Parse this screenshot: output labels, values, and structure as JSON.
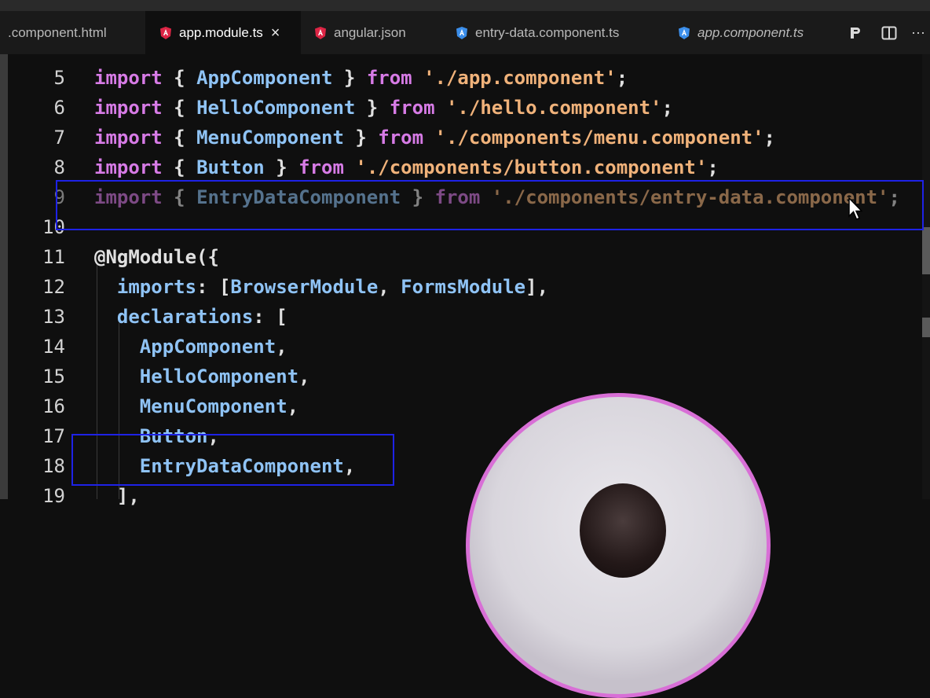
{
  "tabs": [
    {
      "label": ".component.html",
      "icon": "html-file-icon",
      "active": false,
      "italic": false
    },
    {
      "label": "app.module.ts",
      "icon": "angular-icon",
      "active": true,
      "italic": false,
      "close": "×"
    },
    {
      "label": "angular.json",
      "icon": "angular-icon",
      "active": false,
      "italic": false
    },
    {
      "label": "entry-data.component.ts",
      "icon": "angular-component-icon",
      "active": false,
      "italic": false
    },
    {
      "label": "app.component.ts",
      "icon": "angular-component-icon",
      "active": false,
      "italic": true
    }
  ],
  "toolbar": {
    "preview_icon": "preview-icon",
    "split_icon": "split-editor-icon",
    "more": "···"
  },
  "colors": {
    "keyword": "#d77be6",
    "identifier": "#8fc3f5",
    "string": "#f0b27a",
    "highlight_box": "#1e22e6",
    "angular_red": "#dd2545",
    "angular_blue": "#3b8eea"
  },
  "lines": [
    {
      "n": "5",
      "tokens": [
        [
          "kw",
          "import"
        ],
        [
          "pun",
          " { "
        ],
        [
          "id",
          "AppComponent"
        ],
        [
          "pun",
          " } "
        ],
        [
          "kw",
          "from"
        ],
        [
          "pun",
          " "
        ],
        [
          "str",
          "'./app.component'"
        ],
        [
          "pun",
          ";"
        ]
      ]
    },
    {
      "n": "6",
      "tokens": [
        [
          "kw",
          "import"
        ],
        [
          "pun",
          " { "
        ],
        [
          "id",
          "HelloComponent"
        ],
        [
          "pun",
          " } "
        ],
        [
          "kw",
          "from"
        ],
        [
          "pun",
          " "
        ],
        [
          "str",
          "'./hello.component'"
        ],
        [
          "pun",
          ";"
        ]
      ]
    },
    {
      "n": "7",
      "tokens": [
        [
          "kw",
          "import"
        ],
        [
          "pun",
          " { "
        ],
        [
          "id",
          "MenuComponent"
        ],
        [
          "pun",
          " } "
        ],
        [
          "kw",
          "from"
        ],
        [
          "pun",
          " "
        ],
        [
          "str",
          "'./components/menu.component'"
        ],
        [
          "pun",
          ";"
        ]
      ]
    },
    {
      "n": "8",
      "tokens": [
        [
          "kw",
          "import"
        ],
        [
          "pun",
          " { "
        ],
        [
          "id",
          "Button"
        ],
        [
          "pun",
          " } "
        ],
        [
          "kw",
          "from"
        ],
        [
          "pun",
          " "
        ],
        [
          "str",
          "'./components/button.component'"
        ],
        [
          "pun",
          ";"
        ]
      ]
    },
    {
      "n": "9",
      "faded": true,
      "tokens": [
        [
          "kw",
          "import"
        ],
        [
          "pun",
          " { "
        ],
        [
          "id",
          "EntryDataComponent"
        ],
        [
          "pun",
          " } "
        ],
        [
          "kw",
          "from"
        ],
        [
          "pun",
          " "
        ],
        [
          "str",
          "'./components/entry-data.component'"
        ],
        [
          "pun",
          ";"
        ]
      ]
    },
    {
      "n": "10",
      "tokens": []
    },
    {
      "n": "11",
      "tokens": [
        [
          "dec",
          "@NgModule"
        ],
        [
          "pun",
          "({"
        ]
      ]
    },
    {
      "n": "12",
      "tokens": [
        [
          "pun",
          "  "
        ],
        [
          "prop",
          "imports"
        ],
        [
          "pun",
          ": ["
        ],
        [
          "id",
          "BrowserModule"
        ],
        [
          "pun",
          ", "
        ],
        [
          "id",
          "FormsModule"
        ],
        [
          "pun",
          "],"
        ]
      ]
    },
    {
      "n": "13",
      "tokens": [
        [
          "pun",
          "  "
        ],
        [
          "prop",
          "declarations"
        ],
        [
          "pun",
          ": ["
        ]
      ]
    },
    {
      "n": "14",
      "tokens": [
        [
          "pun",
          "    "
        ],
        [
          "id",
          "AppComponent"
        ],
        [
          "pun",
          ","
        ]
      ]
    },
    {
      "n": "15",
      "tokens": [
        [
          "pun",
          "    "
        ],
        [
          "id",
          "HelloComponent"
        ],
        [
          "pun",
          ","
        ]
      ]
    },
    {
      "n": "16",
      "tokens": [
        [
          "pun",
          "    "
        ],
        [
          "id",
          "MenuComponent"
        ],
        [
          "pun",
          ","
        ]
      ]
    },
    {
      "n": "17",
      "tokens": [
        [
          "pun",
          "    "
        ],
        [
          "id",
          "Button"
        ],
        [
          "pun",
          ","
        ]
      ]
    },
    {
      "n": "18",
      "tokens": [
        [
          "pun",
          "    "
        ],
        [
          "id",
          "EntryDataComponent"
        ],
        [
          "pun",
          ","
        ]
      ]
    },
    {
      "n": "19",
      "tokens": [
        [
          "pun",
          "  ],"
        ]
      ]
    }
  ]
}
